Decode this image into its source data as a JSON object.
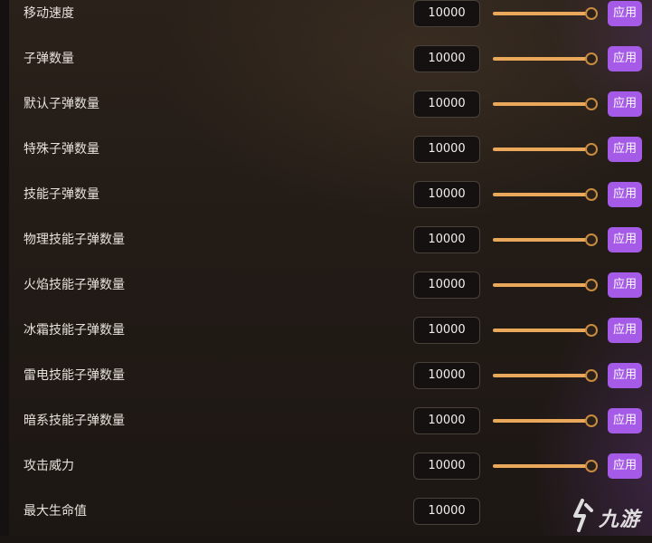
{
  "settings": {
    "rows": [
      {
        "label": "移动速度",
        "value": "10000",
        "slider_fraction": 1.0,
        "apply_label": "应用"
      },
      {
        "label": "子弹数量",
        "value": "10000",
        "slider_fraction": 1.0,
        "apply_label": "应用"
      },
      {
        "label": "默认子弹数量",
        "value": "10000",
        "slider_fraction": 1.0,
        "apply_label": "应用"
      },
      {
        "label": "特殊子弹数量",
        "value": "10000",
        "slider_fraction": 1.0,
        "apply_label": "应用"
      },
      {
        "label": "技能子弹数量",
        "value": "10000",
        "slider_fraction": 1.0,
        "apply_label": "应用"
      },
      {
        "label": "物理技能子弹数量",
        "value": "10000",
        "slider_fraction": 1.0,
        "apply_label": "应用"
      },
      {
        "label": "火焰技能子弹数量",
        "value": "10000",
        "slider_fraction": 1.0,
        "apply_label": "应用"
      },
      {
        "label": "冰霜技能子弹数量",
        "value": "10000",
        "slider_fraction": 1.0,
        "apply_label": "应用"
      },
      {
        "label": "雷电技能子弹数量",
        "value": "10000",
        "slider_fraction": 1.0,
        "apply_label": "应用"
      },
      {
        "label": "暗系技能子弹数量",
        "value": "10000",
        "slider_fraction": 1.0,
        "apply_label": "应用"
      },
      {
        "label": "攻击威力",
        "value": "10000",
        "slider_fraction": 1.0,
        "apply_label": "应用"
      },
      {
        "label": "最大生命值",
        "value": "10000"
      }
    ]
  },
  "watermark": {
    "text": "九游",
    "icon": "jiuyou-logo-icon"
  },
  "colors": {
    "accent_button": "#a55be8",
    "slider_fill": "#e9a85a",
    "slider_thumb_border": "#c98b3f",
    "background": "#221b16"
  }
}
